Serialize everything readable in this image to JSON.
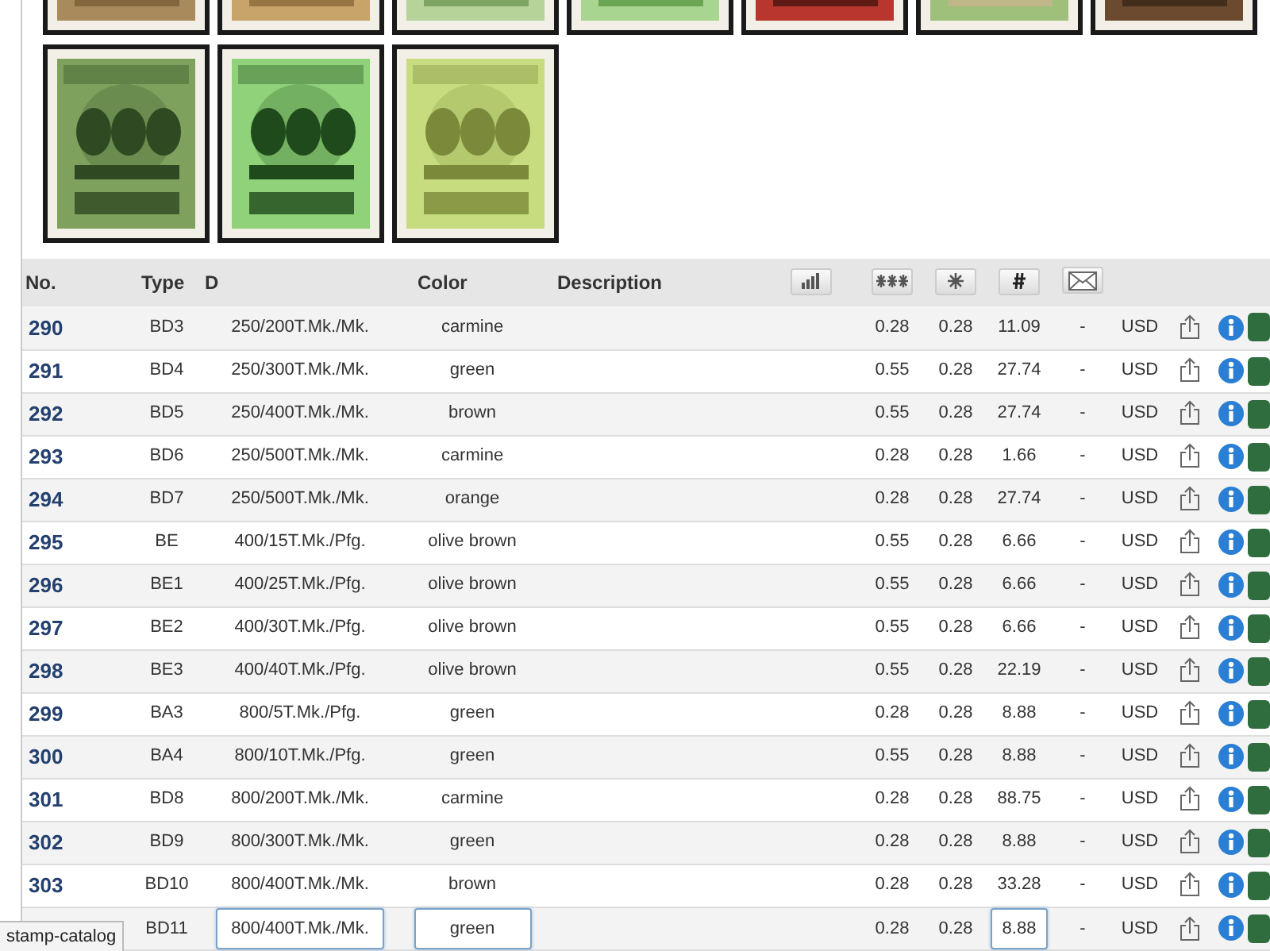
{
  "table": {
    "columns": [
      {
        "kind": "text",
        "label": "No."
      },
      {
        "kind": "text",
        "label": "Type"
      },
      {
        "kind": "text",
        "label": "D"
      },
      {
        "kind": "text",
        "label": "Color"
      },
      {
        "kind": "text",
        "label": "Description"
      },
      {
        "kind": "icon"
      },
      {
        "kind": "icon"
      },
      {
        "kind": "icon"
      },
      {
        "kind": "icon"
      },
      {
        "kind": "icon"
      }
    ],
    "rows": [
      {
        "no": "290",
        "type": "BD3",
        "d": "250/200T.Mk./Mk.",
        "stamp_color": "carmine",
        "price_1": "0.28",
        "price_2": "0.28",
        "price_3": "11.09",
        "price_4": "-",
        "currency": "USD",
        "editing": false
      },
      {
        "no": "291",
        "type": "BD4",
        "d": "250/300T.Mk./Mk.",
        "stamp_color": "green",
        "price_1": "0.55",
        "price_2": "0.28",
        "price_3": "27.74",
        "price_4": "-",
        "currency": "USD",
        "editing": false
      },
      {
        "no": "292",
        "type": "BD5",
        "d": "250/400T.Mk./Mk.",
        "stamp_color": "brown",
        "price_1": "0.55",
        "price_2": "0.28",
        "price_3": "27.74",
        "price_4": "-",
        "currency": "USD",
        "editing": false
      },
      {
        "no": "293",
        "type": "BD6",
        "d": "250/500T.Mk./Mk.",
        "stamp_color": "carmine",
        "price_1": "0.28",
        "price_2": "0.28",
        "price_3": "1.66",
        "price_4": "-",
        "currency": "USD",
        "editing": false
      },
      {
        "no": "294",
        "type": "BD7",
        "d": "250/500T.Mk./Mk.",
        "stamp_color": "orange",
        "price_1": "0.28",
        "price_2": "0.28",
        "price_3": "27.74",
        "price_4": "-",
        "currency": "USD",
        "editing": false
      },
      {
        "no": "295",
        "type": "BE",
        "d": "400/15T.Mk./Pfg.",
        "stamp_color": "olive brown",
        "price_1": "0.55",
        "price_2": "0.28",
        "price_3": "6.66",
        "price_4": "-",
        "currency": "USD",
        "editing": false
      },
      {
        "no": "296",
        "type": "BE1",
        "d": "400/25T.Mk./Pfg.",
        "stamp_color": "olive brown",
        "price_1": "0.55",
        "price_2": "0.28",
        "price_3": "6.66",
        "price_4": "-",
        "currency": "USD",
        "editing": false
      },
      {
        "no": "297",
        "type": "BE2",
        "d": "400/30T.Mk./Pfg.",
        "stamp_color": "olive brown",
        "price_1": "0.55",
        "price_2": "0.28",
        "price_3": "6.66",
        "price_4": "-",
        "currency": "USD",
        "editing": false
      },
      {
        "no": "298",
        "type": "BE3",
        "d": "400/40T.Mk./Pfg.",
        "stamp_color": "olive brown",
        "price_1": "0.55",
        "price_2": "0.28",
        "price_3": "22.19",
        "price_4": "-",
        "currency": "USD",
        "editing": false
      },
      {
        "no": "299",
        "type": "BA3",
        "d": "800/5T.Mk./Pfg.",
        "stamp_color": "green",
        "price_1": "0.28",
        "price_2": "0.28",
        "price_3": "8.88",
        "price_4": "-",
        "currency": "USD",
        "editing": false
      },
      {
        "no": "300",
        "type": "BA4",
        "d": "800/10T.Mk./Pfg.",
        "stamp_color": "green",
        "price_1": "0.55",
        "price_2": "0.28",
        "price_3": "8.88",
        "price_4": "-",
        "currency": "USD",
        "editing": false
      },
      {
        "no": "301",
        "type": "BD8",
        "d": "800/200T.Mk./Mk.",
        "stamp_color": "carmine",
        "price_1": "0.28",
        "price_2": "0.28",
        "price_3": "88.75",
        "price_4": "-",
        "currency": "USD",
        "editing": false
      },
      {
        "no": "302",
        "type": "BD9",
        "d": "800/300T.Mk./Mk.",
        "stamp_color": "green",
        "price_1": "0.28",
        "price_2": "0.28",
        "price_3": "8.88",
        "price_4": "-",
        "currency": "USD",
        "editing": false
      },
      {
        "no": "303",
        "type": "BD10",
        "d": "800/400T.Mk./Mk.",
        "stamp_color": "brown",
        "price_1": "0.28",
        "price_2": "0.28",
        "price_3": "33.28",
        "price_4": "-",
        "currency": "USD",
        "editing": false
      },
      {
        "type": "BD11",
        "d": "800/400T.Mk./Mk.",
        "stamp_color": "green",
        "price_1": "0.28",
        "price_2": "0.28",
        "price_3": "8.88",
        "price_4": "-",
        "currency": "USD",
        "editing": true
      }
    ]
  },
  "status_text": "stamp-catalog"
}
